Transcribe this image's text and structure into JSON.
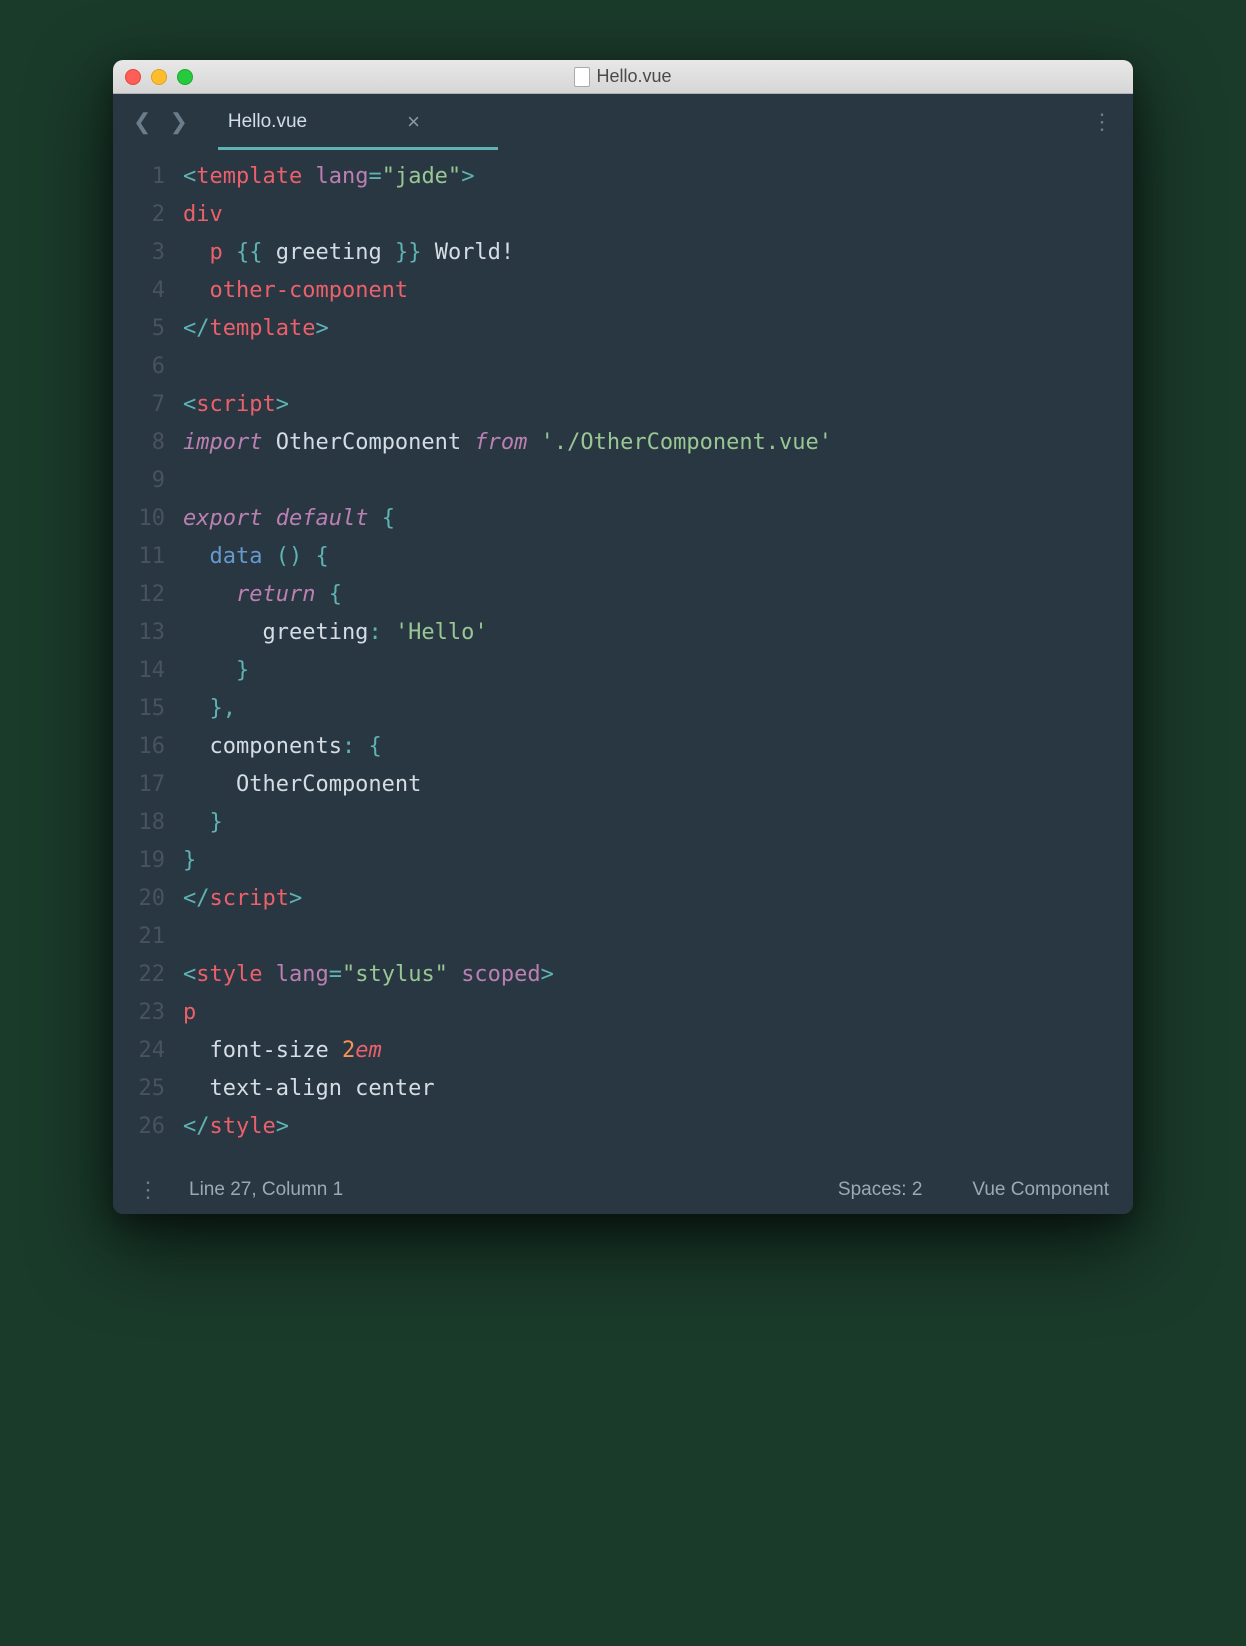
{
  "window": {
    "title": "Hello.vue"
  },
  "tab": {
    "name": "Hello.vue"
  },
  "status": {
    "cursor": "Line 27, Column 1",
    "spaces": "Spaces: 2",
    "syntax": "Vue Component"
  },
  "code": {
    "lines": [
      {
        "n": 1,
        "tokens": [
          [
            "<",
            "punc"
          ],
          [
            "template",
            "tag"
          ],
          [
            " ",
            ""
          ],
          [
            "lang",
            "attr"
          ],
          [
            "=",
            "punc"
          ],
          [
            "\"jade\"",
            "str"
          ],
          [
            ">",
            "punc"
          ]
        ]
      },
      {
        "n": 2,
        "tokens": [
          [
            "div",
            "tag"
          ]
        ]
      },
      {
        "n": 3,
        "tokens": [
          [
            "  ",
            ""
          ],
          [
            "p",
            "tag"
          ],
          [
            " ",
            ""
          ],
          [
            "{{",
            "punc"
          ],
          [
            " greeting ",
            ""
          ],
          [
            "}}",
            "punc"
          ],
          [
            " World!",
            ""
          ]
        ]
      },
      {
        "n": 4,
        "tokens": [
          [
            "  ",
            ""
          ],
          [
            "other-component",
            "tag"
          ]
        ]
      },
      {
        "n": 5,
        "tokens": [
          [
            "</",
            "punc"
          ],
          [
            "template",
            "tag"
          ],
          [
            ">",
            "punc"
          ]
        ]
      },
      {
        "n": 6,
        "tokens": [
          [
            "",
            ""
          ]
        ]
      },
      {
        "n": 7,
        "tokens": [
          [
            "<",
            "punc"
          ],
          [
            "script",
            "tag"
          ],
          [
            ">",
            "punc"
          ]
        ]
      },
      {
        "n": 8,
        "tokens": [
          [
            "import",
            "kw"
          ],
          [
            " OtherComponent ",
            ""
          ],
          [
            "from",
            "kw"
          ],
          [
            " ",
            ""
          ],
          [
            "'./OtherComponent.vue'",
            "str"
          ]
        ]
      },
      {
        "n": 9,
        "tokens": [
          [
            "",
            ""
          ]
        ]
      },
      {
        "n": 10,
        "tokens": [
          [
            "export",
            "kw"
          ],
          [
            " ",
            ""
          ],
          [
            "default",
            "kw"
          ],
          [
            " ",
            ""
          ],
          [
            "{",
            "punc"
          ]
        ]
      },
      {
        "n": 11,
        "tokens": [
          [
            "  ",
            ""
          ],
          [
            "data",
            "func"
          ],
          [
            " ",
            "punc"
          ],
          [
            "()",
            "punc"
          ],
          [
            " ",
            ""
          ],
          [
            "{",
            "punc"
          ]
        ]
      },
      {
        "n": 12,
        "tokens": [
          [
            "    ",
            ""
          ],
          [
            "return",
            "kw"
          ],
          [
            " ",
            ""
          ],
          [
            "{",
            "punc"
          ]
        ]
      },
      {
        "n": 13,
        "tokens": [
          [
            "      greeting",
            ""
          ],
          [
            ":",
            "punc"
          ],
          [
            " ",
            ""
          ],
          [
            "'Hello'",
            "str"
          ]
        ]
      },
      {
        "n": 14,
        "tokens": [
          [
            "    ",
            ""
          ],
          [
            "}",
            "punc"
          ]
        ]
      },
      {
        "n": 15,
        "tokens": [
          [
            "  ",
            ""
          ],
          [
            "},",
            "punc"
          ]
        ]
      },
      {
        "n": 16,
        "tokens": [
          [
            "  components",
            ""
          ],
          [
            ":",
            "punc"
          ],
          [
            " ",
            ""
          ],
          [
            "{",
            "punc"
          ]
        ]
      },
      {
        "n": 17,
        "tokens": [
          [
            "    OtherComponent",
            ""
          ]
        ]
      },
      {
        "n": 18,
        "tokens": [
          [
            "  ",
            ""
          ],
          [
            "}",
            "punc"
          ]
        ]
      },
      {
        "n": 19,
        "tokens": [
          [
            "}",
            "punc"
          ]
        ]
      },
      {
        "n": 20,
        "tokens": [
          [
            "</",
            "punc"
          ],
          [
            "script",
            "tag"
          ],
          [
            ">",
            "punc"
          ]
        ]
      },
      {
        "n": 21,
        "tokens": [
          [
            "",
            ""
          ]
        ]
      },
      {
        "n": 22,
        "tokens": [
          [
            "<",
            "punc"
          ],
          [
            "style",
            "tag"
          ],
          [
            " ",
            ""
          ],
          [
            "lang",
            "attr"
          ],
          [
            "=",
            "punc"
          ],
          [
            "\"stylus\"",
            "str"
          ],
          [
            " ",
            ""
          ],
          [
            "scoped",
            "attr"
          ],
          [
            ">",
            "punc"
          ]
        ]
      },
      {
        "n": 23,
        "tokens": [
          [
            "p",
            "tag"
          ]
        ]
      },
      {
        "n": 24,
        "tokens": [
          [
            "  font-size ",
            ""
          ],
          [
            "2",
            "num"
          ],
          [
            "em",
            "unit"
          ]
        ]
      },
      {
        "n": 25,
        "tokens": [
          [
            "  text-align center",
            ""
          ]
        ]
      },
      {
        "n": 26,
        "tokens": [
          [
            "</",
            "punc"
          ],
          [
            "style",
            "tag"
          ],
          [
            ">",
            "punc"
          ]
        ]
      }
    ]
  }
}
